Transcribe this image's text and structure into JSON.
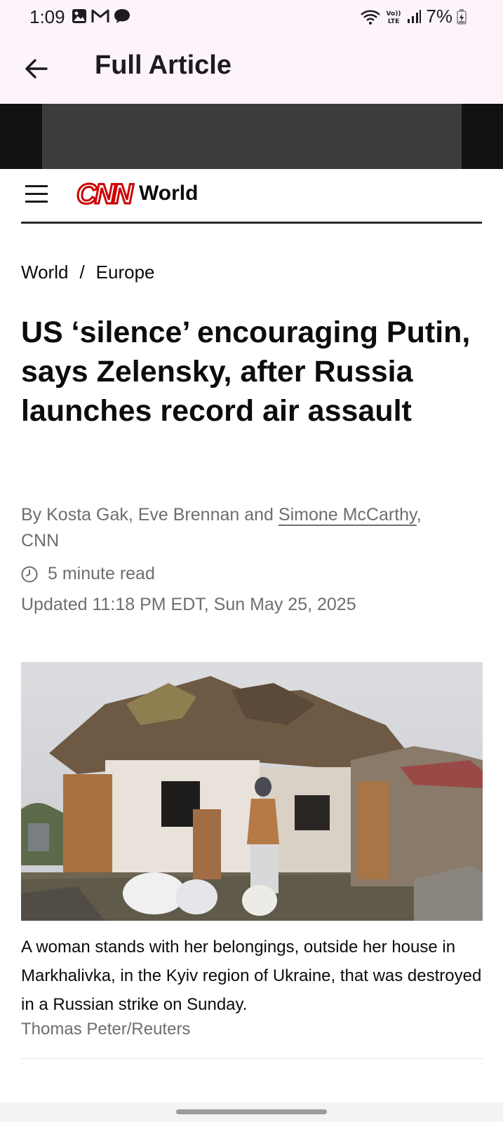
{
  "status_bar": {
    "time": "1:09",
    "battery_percent": "7%",
    "left_icons": [
      "gallery-icon",
      "gmail-icon",
      "chat-bubble-icon"
    ],
    "right_icons": [
      "wifi-icon",
      "volte-icon",
      "signal-icon",
      "battery-charging-icon"
    ],
    "volte_label": "Vo))\nLTE"
  },
  "app_bar": {
    "title": "Full Article",
    "back_icon": "arrow-left-icon"
  },
  "cnn_header": {
    "logo_text": "CNN",
    "section": "World",
    "logo_color": "#cc0000"
  },
  "breadcrumb": {
    "items": [
      "World",
      "Europe"
    ],
    "separator": "/"
  },
  "article": {
    "headline": "US ‘silence’ encouraging Putin, says Zelensky, after Russia launches record air assault",
    "byline_prefix": "By Kosta Gak, Eve Brennan and ",
    "byline_link": "Simone McCarthy",
    "byline_suffix": ",",
    "byline_outlet": "CNN",
    "read_time": "5 minute read",
    "updated": "Updated 11:18 PM EDT, Sun May 25, 2025",
    "photo_caption": "A woman stands with her belongings, outside her house in Markhalivka, in the Kyiv region of Ukraine, that was destroyed in a Russian strike on Sunday.",
    "photo_credit": "Thomas Peter/Reuters"
  }
}
